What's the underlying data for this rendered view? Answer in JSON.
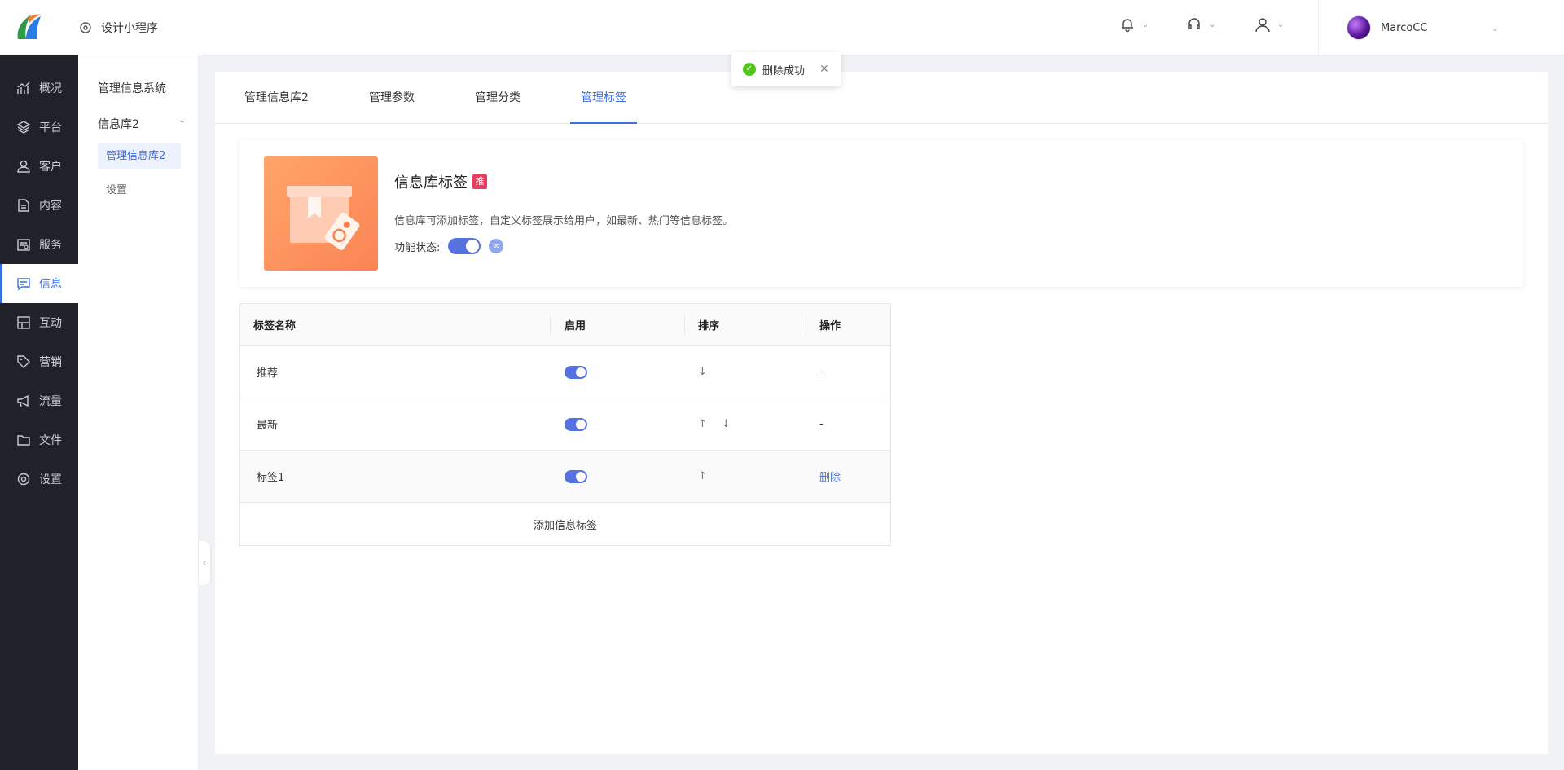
{
  "header": {
    "app_name": "设计小程序",
    "user_name": "MarcoCC"
  },
  "sidebar": {
    "items": [
      {
        "label": "概况",
        "icon": "chart-line-icon"
      },
      {
        "label": "平台",
        "icon": "layers-icon"
      },
      {
        "label": "客户",
        "icon": "user-icon"
      },
      {
        "label": "内容",
        "icon": "document-icon"
      },
      {
        "label": "服务",
        "icon": "service-icon"
      },
      {
        "label": "信息",
        "icon": "message-icon"
      },
      {
        "label": "互动",
        "icon": "interaction-icon"
      },
      {
        "label": "营销",
        "icon": "tag-icon"
      },
      {
        "label": "流量",
        "icon": "megaphone-icon"
      },
      {
        "label": "文件",
        "icon": "folder-icon"
      },
      {
        "label": "设置",
        "icon": "settings-icon"
      }
    ],
    "active_index": 5
  },
  "subnav": {
    "title": "管理信息系统",
    "group": "信息库2",
    "group_toggle": "-",
    "items": [
      "管理信息库2",
      "设置"
    ]
  },
  "tabs": [
    "管理信息库2",
    "管理参数",
    "管理分类",
    "管理标签"
  ],
  "feature": {
    "title": "信息库标签",
    "badge": "推",
    "description": "信息库可添加标签，自定义标签展示给用户，如最新、热门等信息标签。",
    "status_label": "功能状态:",
    "enabled": true
  },
  "table": {
    "columns": [
      "标签名称",
      "启用",
      "排序",
      "操作"
    ],
    "rows": [
      {
        "name": "推荐",
        "enabled": true,
        "up": false,
        "down": true,
        "action": "-"
      },
      {
        "name": "最新",
        "enabled": true,
        "up": true,
        "down": true,
        "action": "-"
      },
      {
        "name": "标签1",
        "enabled": true,
        "up": true,
        "down": false,
        "action": "删除"
      }
    ],
    "add_label": "添加信息标签"
  },
  "toast": {
    "message": "删除成功"
  },
  "colors": {
    "accent": "#3e6ce4",
    "sidebar_bg": "#1f2229",
    "badge": "#e53e5f",
    "success": "#52c41a"
  }
}
